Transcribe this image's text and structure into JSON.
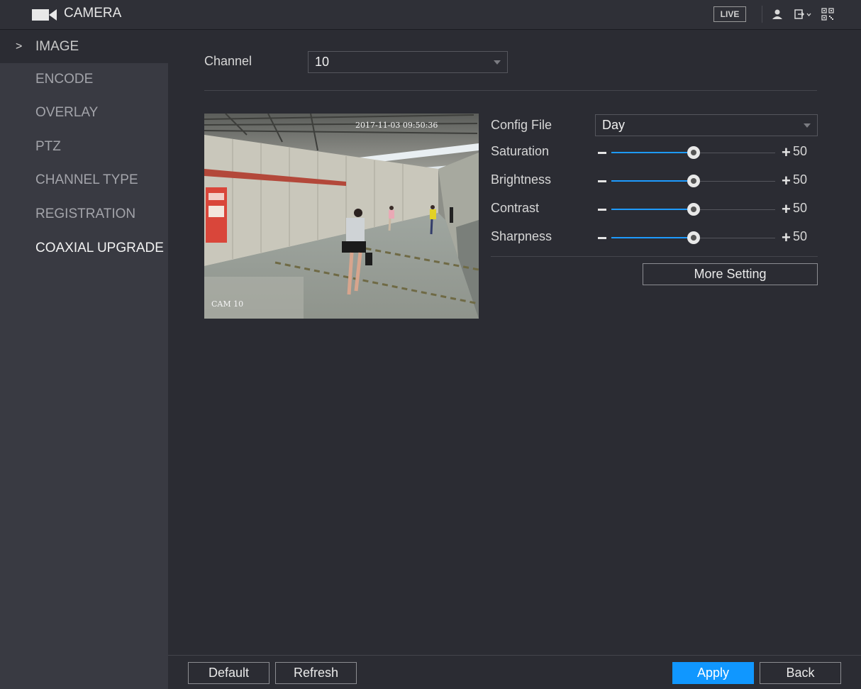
{
  "header": {
    "title": "CAMERA",
    "live_label": "LIVE",
    "icons": [
      "camera-icon",
      "user-icon",
      "logout-icon",
      "qr-code-icon"
    ]
  },
  "sidebar": {
    "items": [
      {
        "label": "IMAGE"
      },
      {
        "label": "ENCODE"
      },
      {
        "label": "OVERLAY"
      },
      {
        "label": "PTZ"
      },
      {
        "label": "CHANNEL TYPE"
      },
      {
        "label": "REGISTRATION"
      },
      {
        "label": "COAXIAL UPGRADE"
      }
    ],
    "active_index": 0
  },
  "main": {
    "channel_label": "Channel",
    "channel_value": "10",
    "preview": {
      "timestamp": "2017-11-03 09:50:36",
      "camera_name": "CAM 10"
    },
    "config_file_label": "Config File",
    "config_file_value": "Day",
    "sliders": [
      {
        "label": "Saturation",
        "value": "50",
        "level": 0.5
      },
      {
        "label": "Brightness",
        "value": "50",
        "level": 0.5
      },
      {
        "label": "Contrast",
        "value": "50",
        "level": 0.5
      },
      {
        "label": "Sharpness",
        "value": "50",
        "level": 0.5
      }
    ],
    "more_setting_label": "More Setting"
  },
  "footer": {
    "default_label": "Default",
    "refresh_label": "Refresh",
    "apply_label": "Apply",
    "back_label": "Back"
  },
  "colors": {
    "accent": "#1097ff",
    "background": "#2b2c33",
    "sidebar": "#393a42"
  }
}
